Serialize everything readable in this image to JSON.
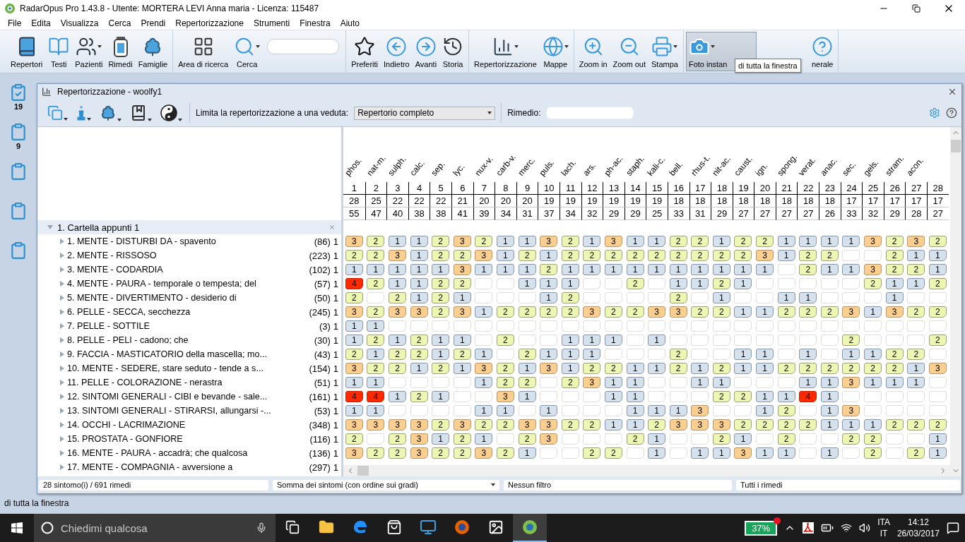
{
  "window": {
    "title": "RadarOpus Pro 1.43.8 - Utente: MORTERA LEVI Anna maria - Licenza: 115487"
  },
  "menu": [
    "File",
    "Edita",
    "Visualizza",
    "Cerca",
    "Prendi",
    "Repertorizzazione",
    "Strumenti",
    "Finestra",
    "Aiuto"
  ],
  "toolbar": {
    "tooltip": "di tutta la finestra",
    "groups": [
      [
        {
          "kind": "book",
          "label": "Repertori",
          "dropdown": false,
          "pressed": false
        },
        {
          "kind": "open-book",
          "label": "Testi",
          "dropdown": false,
          "pressed": false
        },
        {
          "kind": "people",
          "label": "Pazienti",
          "dropdown": true,
          "pressed": false
        },
        {
          "kind": "jar",
          "label": "Rimedi",
          "dropdown": false,
          "pressed": false
        },
        {
          "kind": "tree",
          "label": "Famiglie",
          "dropdown": false,
          "pressed": false
        }
      ],
      [
        {
          "kind": "target-grid",
          "label": "Area di ricerca",
          "dropdown": false,
          "pressed": false
        },
        {
          "kind": "magnifier",
          "label": "Cerca",
          "dropdown": true,
          "pressed": false
        },
        {
          "kind": "field"
        }
      ],
      [
        {
          "kind": "star",
          "label": "Preferiti",
          "dropdown": false,
          "pressed": false
        },
        {
          "kind": "back",
          "label": "Indietro",
          "dropdown": false,
          "pressed": false
        },
        {
          "kind": "forward",
          "label": "Avanti",
          "dropdown": false,
          "pressed": false
        },
        {
          "kind": "history",
          "label": "Storia",
          "dropdown": false,
          "pressed": false
        }
      ],
      [
        {
          "kind": "chart",
          "label": "Repertorizzazione",
          "dropdown": true,
          "pressed": false
        },
        {
          "kind": "globe",
          "label": "Mappe",
          "dropdown": true,
          "pressed": false
        }
      ],
      [
        {
          "kind": "zoom-in",
          "label": "Zoom in",
          "dropdown": false,
          "pressed": false
        },
        {
          "kind": "zoom-out",
          "label": "Zoom out",
          "dropdown": false,
          "pressed": false
        },
        {
          "kind": "printer",
          "label": "Stampa",
          "dropdown": true,
          "pressed": false
        }
      ],
      [
        {
          "kind": "camera",
          "label": "Foto instan",
          "dropdown": true,
          "pressed": true
        },
        {
          "kind": "help",
          "label": "nerale",
          "dropdown": false,
          "pressed": false
        }
      ]
    ]
  },
  "dock": [
    {
      "checked": true,
      "count": "19"
    },
    {
      "checked": false,
      "count": "9"
    },
    {
      "checked": false
    },
    {
      "checked": false
    },
    {
      "checked": false
    }
  ],
  "panel": {
    "title": "Repertorizzazione - woolfy1",
    "tools": [
      {
        "kind": "windows"
      },
      {
        "kind": "chess"
      },
      {
        "kind": "tree"
      },
      {
        "kind": "globe-book"
      },
      {
        "kind": "yin-yang"
      }
    ],
    "filter_label": "Limita la repertorizzazione a una veduta:",
    "filter_value": "Repertorio completo",
    "remedy_label": "Rimedio:",
    "group": {
      "label": "1. Cartella appunti 1",
      "expanded": true
    },
    "symptoms": [
      {
        "label": "1. MENTE - DISTURBI DA - spavento",
        "count": "(86)",
        "weight": "1"
      },
      {
        "label": "2. MENTE - RISSOSO",
        "count": "(223)",
        "weight": "1"
      },
      {
        "label": "3. MENTE - CODARDIA",
        "count": "(102)",
        "weight": "1"
      },
      {
        "label": "4. MENTE - PAURA - temporale o tempesta; del",
        "count": "(57)",
        "weight": "1"
      },
      {
        "label": "5. MENTE - DIVERTIMENTO - desiderio di",
        "count": "(50)",
        "weight": "1"
      },
      {
        "label": "6. PELLE - SECCA, secchezza",
        "count": "(245)",
        "weight": "1"
      },
      {
        "label": "7. PELLE - SOTTILE",
        "count": "(3)",
        "weight": "1"
      },
      {
        "label": "8. PELLE - PELI - cadono; che",
        "count": "(30)",
        "weight": "1"
      },
      {
        "label": "9. FACCIA - MASTICATORIO della mascella; mo...",
        "count": "(43)",
        "weight": "1"
      },
      {
        "label": "10. MENTE - SEDERE, stare seduto - tende a s...",
        "count": "(154)",
        "weight": "1"
      },
      {
        "label": "11. PELLE - COLORAZIONE - nerastra",
        "count": "(51)",
        "weight": "1"
      },
      {
        "label": "12. SINTOMI GENERALI - CIBI e bevande - sale...",
        "count": "(161)",
        "weight": "1"
      },
      {
        "label": "13. SINTOMI GENERALI - STIRARSI, allungarsi -...",
        "count": "(53)",
        "weight": "1"
      },
      {
        "label": "14. OCCHI - LACRIMAZIONE",
        "count": "(348)",
        "weight": "1"
      },
      {
        "label": "15. PROSTATA - GONFIORE",
        "count": "(116)",
        "weight": "1"
      },
      {
        "label": "16. MENTE - PAURA - accadrà; che qualcosa",
        "count": "(136)",
        "weight": "1"
      },
      {
        "label": "17. MENTE - COMPAGNIA - avversione a",
        "count": "(297)",
        "weight": "1"
      }
    ],
    "grid": {
      "columns": [
        {
          "name": "phos.",
          "rank": "1",
          "symptoms": "28",
          "degrees": "55"
        },
        {
          "name": "nat-m.",
          "rank": "2",
          "symptoms": "25",
          "degrees": "47"
        },
        {
          "name": "sulph.",
          "rank": "3",
          "symptoms": "22",
          "degrees": "40"
        },
        {
          "name": "calc.",
          "rank": "4",
          "symptoms": "22",
          "degrees": "38"
        },
        {
          "name": "sep.",
          "rank": "5",
          "symptoms": "22",
          "degrees": "38"
        },
        {
          "name": "lyc.",
          "rank": "6",
          "symptoms": "21",
          "degrees": "41"
        },
        {
          "name": "nux-v.",
          "rank": "7",
          "symptoms": "20",
          "degrees": "39"
        },
        {
          "name": "carb-v.",
          "rank": "8",
          "symptoms": "20",
          "degrees": "34"
        },
        {
          "name": "merc.",
          "rank": "9",
          "symptoms": "20",
          "degrees": "31"
        },
        {
          "name": "puls.",
          "rank": "10",
          "symptoms": "19",
          "degrees": "37"
        },
        {
          "name": "lach.",
          "rank": "11",
          "symptoms": "19",
          "degrees": "34"
        },
        {
          "name": "ars.",
          "rank": "12",
          "symptoms": "19",
          "degrees": "32"
        },
        {
          "name": "ph-ac.",
          "rank": "13",
          "symptoms": "19",
          "degrees": "29"
        },
        {
          "name": "staph.",
          "rank": "14",
          "symptoms": "19",
          "degrees": "29"
        },
        {
          "name": "kali-c.",
          "rank": "15",
          "symptoms": "19",
          "degrees": "25"
        },
        {
          "name": "bell.",
          "rank": "16",
          "symptoms": "18",
          "degrees": "33"
        },
        {
          "name": "rhus-t.",
          "rank": "17",
          "symptoms": "18",
          "degrees": "31"
        },
        {
          "name": "nit-ac.",
          "rank": "18",
          "symptoms": "18",
          "degrees": "29"
        },
        {
          "name": "caust.",
          "rank": "19",
          "symptoms": "18",
          "degrees": "27"
        },
        {
          "name": "ign.",
          "rank": "20",
          "symptoms": "18",
          "degrees": "27"
        },
        {
          "name": "spong.",
          "rank": "21",
          "symptoms": "18",
          "degrees": "27"
        },
        {
          "name": "verat.",
          "rank": "22",
          "symptoms": "18",
          "degrees": "27"
        },
        {
          "name": "anac.",
          "rank": "23",
          "symptoms": "18",
          "degrees": "26"
        },
        {
          "name": "sec.",
          "rank": "24",
          "symptoms": "17",
          "degrees": "33"
        },
        {
          "name": "gels.",
          "rank": "25",
          "symptoms": "17",
          "degrees": "32"
        },
        {
          "name": "stram.",
          "rank": "26",
          "symptoms": "17",
          "degrees": "29"
        },
        {
          "name": "acon.",
          "rank": "27",
          "symptoms": "17",
          "degrees": "28"
        },
        {
          "rank": "28",
          "symptoms": "17",
          "degrees": "27"
        }
      ],
      "rows": [
        [
          "3",
          "2",
          "1",
          "1",
          "2",
          "3",
          "2",
          "1",
          "1",
          "3",
          "2",
          "1",
          "3",
          "1",
          "1",
          "2",
          "2",
          "1",
          "2",
          "2",
          "1",
          "1",
          "1",
          "1",
          "3",
          "2",
          "3",
          "2"
        ],
        [
          "2",
          "2",
          "3",
          "1",
          "2",
          "2",
          "3",
          "1",
          "2",
          "1",
          "2",
          "2",
          "2",
          "2",
          "2",
          "2",
          "2",
          "2",
          "2",
          "3",
          "1",
          "2",
          "2",
          null,
          null,
          "2",
          "1",
          "1"
        ],
        [
          "1",
          "1",
          "1",
          "1",
          "1",
          "3",
          "1",
          "1",
          "1",
          "2",
          "1",
          "1",
          "1",
          "1",
          "1",
          "1",
          "1",
          "1",
          "1",
          "1",
          null,
          "2",
          "1",
          "1",
          "3",
          "2",
          "2",
          "1"
        ],
        [
          "4",
          "2",
          "1",
          "1",
          "2",
          "2",
          null,
          null,
          "1",
          "1",
          "1",
          null,
          null,
          "2",
          null,
          "1",
          "1",
          "2",
          "1",
          null,
          null,
          null,
          null,
          null,
          "2",
          "1",
          "1",
          "2"
        ],
        [
          "2",
          null,
          "2",
          "1",
          "2",
          "1",
          null,
          null,
          null,
          "1",
          "2",
          null,
          null,
          null,
          null,
          "2",
          null,
          "1",
          null,
          null,
          "1",
          "1",
          null,
          null,
          null,
          "1",
          null,
          null
        ],
        [
          "3",
          "2",
          "3",
          "3",
          "2",
          "3",
          "1",
          "2",
          "2",
          "2",
          "2",
          "3",
          "2",
          "2",
          "3",
          "3",
          "2",
          "2",
          "1",
          "1",
          "2",
          "2",
          "2",
          "3",
          "1",
          "3",
          "2",
          "2"
        ],
        [
          "1",
          "1",
          null,
          null,
          null,
          null,
          null,
          null,
          null,
          null,
          null,
          null,
          null,
          null,
          null,
          null,
          null,
          null,
          null,
          null,
          null,
          null,
          null,
          null,
          null,
          null,
          null,
          null
        ],
        [
          "1",
          "2",
          "1",
          "2",
          "1",
          "1",
          null,
          "2",
          null,
          null,
          "1",
          "1",
          "1",
          null,
          "1",
          null,
          null,
          null,
          null,
          null,
          null,
          null,
          null,
          "2",
          null,
          null,
          null,
          "2"
        ],
        [
          "2",
          "1",
          "2",
          "2",
          "1",
          "2",
          "1",
          null,
          "2",
          "1",
          "1",
          "1",
          null,
          null,
          null,
          "2",
          null,
          null,
          "1",
          "1",
          null,
          "1",
          null,
          "1",
          "1",
          "2",
          "2",
          null
        ],
        [
          "3",
          "2",
          "2",
          "1",
          "2",
          "1",
          "3",
          "2",
          "1",
          "3",
          "1",
          "2",
          "2",
          "1",
          "1",
          "2",
          "1",
          "2",
          "1",
          "1",
          "2",
          "2",
          "2",
          "2",
          "2",
          "2",
          "1",
          "3"
        ],
        [
          "1",
          "1",
          null,
          null,
          null,
          null,
          "1",
          "2",
          "2",
          null,
          "2",
          "3",
          "1",
          "1",
          null,
          null,
          "1",
          "1",
          null,
          null,
          null,
          "1",
          "1",
          "3",
          "1",
          "1",
          "1",
          null
        ],
        [
          "4",
          "4",
          "1",
          "2",
          "1",
          null,
          null,
          "3",
          "1",
          null,
          null,
          null,
          "1",
          "1",
          null,
          null,
          null,
          "2",
          "2",
          "1",
          "1",
          "4",
          "1",
          null,
          null,
          null,
          null,
          null
        ],
        [
          "1",
          "1",
          null,
          null,
          null,
          null,
          "1",
          "1",
          null,
          "1",
          null,
          null,
          null,
          "1",
          "1",
          "1",
          "3",
          null,
          null,
          "1",
          "2",
          null,
          "1",
          "3",
          null,
          null,
          null,
          null
        ],
        [
          "3",
          "3",
          "3",
          "3",
          "2",
          "3",
          "2",
          "2",
          "3",
          "3",
          "2",
          "2",
          "1",
          "1",
          "2",
          "3",
          "3",
          "3",
          "2",
          "2",
          "2",
          "2",
          "1",
          "1",
          "1",
          "2",
          "2",
          "2"
        ],
        [
          "2",
          null,
          "2",
          "3",
          "1",
          "2",
          "1",
          null,
          "2",
          "3",
          null,
          null,
          null,
          "2",
          "1",
          null,
          null,
          "2",
          "1",
          null,
          "2",
          null,
          null,
          "2",
          "2",
          null,
          null,
          "1"
        ],
        [
          "3",
          "2",
          "2",
          "3",
          "2",
          "2",
          "3",
          "2",
          "1",
          null,
          null,
          "2",
          "2",
          null,
          "1",
          null,
          "1",
          "1",
          "3",
          "1",
          "1",
          null,
          "1",
          null,
          "2",
          null,
          "2",
          "1"
        ]
      ]
    },
    "status": [
      "28 sintomo(i) / 691 rimedi",
      "Somma dei sintomi (con ordine sui gradi)",
      "Nessun filtro",
      "Tutti i rimedi"
    ]
  },
  "status_bar": "di tutta la finestra",
  "taskbar": {
    "placeholder": "Chiedimi qualcosa",
    "apps": [
      {
        "kind": "task-view",
        "active": false
      },
      {
        "kind": "folder",
        "active": false
      },
      {
        "kind": "edge",
        "active": false
      },
      {
        "kind": "store",
        "active": false
      },
      {
        "kind": "monitor",
        "active": false
      },
      {
        "kind": "firefox",
        "active": false
      },
      {
        "kind": "photos",
        "active": false
      },
      {
        "kind": "green-app",
        "active": true
      }
    ],
    "battery": "37%",
    "language": "ITA",
    "layout": "IT",
    "time": "14:12",
    "date": "26/03/2017"
  }
}
